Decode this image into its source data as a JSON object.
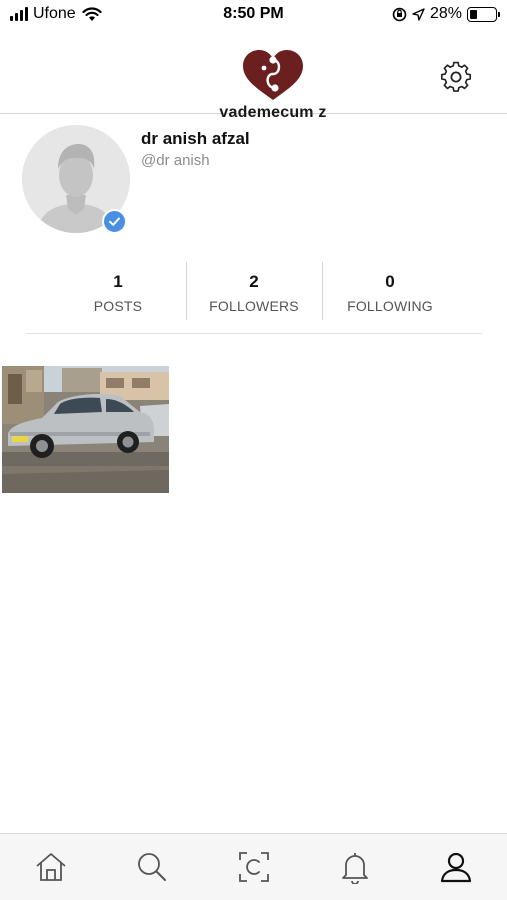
{
  "status_bar": {
    "carrier": "Ufone",
    "time": "8:50 PM",
    "battery_percent": "28%",
    "battery_level": 0.28
  },
  "header": {
    "logo_text": "vademecum z",
    "logo_color": "#6b1f1f"
  },
  "profile": {
    "display_name": "dr anish afzal",
    "username": "@dr anish",
    "verified": true,
    "verified_color": "#4a90e2"
  },
  "stats": [
    {
      "value": "1",
      "label": "POSTS"
    },
    {
      "value": "2",
      "label": "FOLLOWERS"
    },
    {
      "value": "0",
      "label": "FOLLOWING"
    }
  ],
  "posts": [
    {
      "subject": "silver sedan car"
    }
  ],
  "tab_bar": {
    "tabs": [
      {
        "icon": "home-icon"
      },
      {
        "icon": "search-icon"
      },
      {
        "icon": "scan-icon"
      },
      {
        "icon": "bell-icon"
      },
      {
        "icon": "profile-icon",
        "active": true
      }
    ]
  }
}
